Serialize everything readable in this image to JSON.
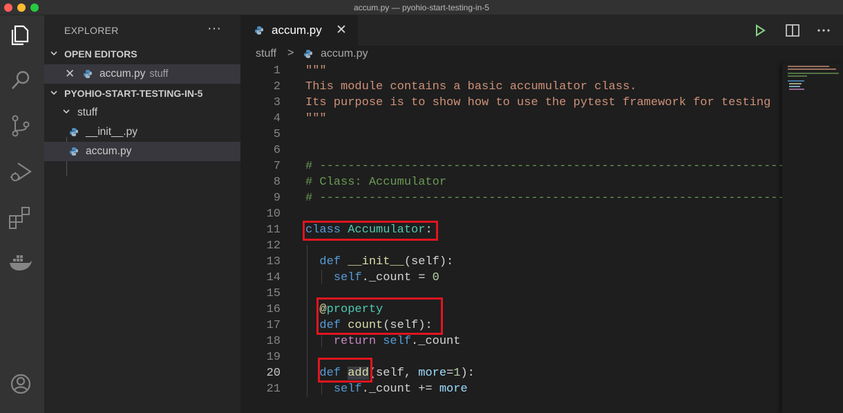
{
  "window": {
    "title": "accum.py — pyohio-start-testing-in-5"
  },
  "activity_bar": {
    "items": [
      {
        "name": "explorer-icon"
      },
      {
        "name": "search-icon"
      },
      {
        "name": "source-control-icon"
      },
      {
        "name": "run-debug-icon"
      },
      {
        "name": "extensions-icon"
      },
      {
        "name": "docker-icon"
      },
      {
        "name": "accounts-icon"
      }
    ]
  },
  "sidebar": {
    "header": "EXPLORER",
    "more_actions": "···",
    "open_editors": {
      "label": "OPEN EDITORS",
      "items": [
        {
          "name": "accum.py",
          "description": "stuff"
        }
      ]
    },
    "workspace": {
      "label": "PYOHIO-START-TESTING-IN-5",
      "folder": "stuff",
      "files": [
        "__init__.py",
        "accum.py"
      ]
    }
  },
  "editor": {
    "tab": {
      "label": "accum.py"
    },
    "breadcrumb": {
      "folder": "stuff",
      "separator": ">",
      "file": "accum.py"
    },
    "active_line": 20,
    "lines": [
      {
        "n": "1",
        "text": "\"\"\""
      },
      {
        "n": "2",
        "text": "This module contains a basic accumulator class."
      },
      {
        "n": "3",
        "text": "Its purpose is to show how to use the pytest framework for testing"
      },
      {
        "n": "4",
        "text": "\"\"\""
      },
      {
        "n": "5",
        "text": ""
      },
      {
        "n": "6",
        "text": ""
      },
      {
        "n": "7",
        "text": "# --------------------------------------------------------------------------"
      },
      {
        "n": "8",
        "text": "# Class: Accumulator"
      },
      {
        "n": "9",
        "text": "# --------------------------------------------------------------------------"
      },
      {
        "n": "10",
        "text": ""
      },
      {
        "n": "11",
        "kw": "class",
        "name": "Accumulator",
        "colon": ":"
      },
      {
        "n": "12",
        "text": ""
      },
      {
        "n": "13",
        "kw": "def",
        "fn": "__init__",
        "params": "(self):"
      },
      {
        "n": "14",
        "obj": "self",
        "attr": "._count = ",
        "num": "0"
      },
      {
        "n": "15",
        "text": ""
      },
      {
        "n": "16",
        "at": "@",
        "decorator": "property"
      },
      {
        "n": "17",
        "kw": "def",
        "fn": "count",
        "params": "(self):"
      },
      {
        "n": "18",
        "ret": "return",
        "obj": "self",
        "attr": "._count"
      },
      {
        "n": "19",
        "text": ""
      },
      {
        "n": "20",
        "kw": "def",
        "fn": "add",
        "p1": "(self, ",
        "p2": "more",
        "p3": "=",
        "num": "1",
        "p4": "):"
      },
      {
        "n": "21",
        "obj": "self",
        "attr": "._count += ",
        "p2": "more"
      }
    ]
  },
  "colors": {
    "string": "#ce9178",
    "comment": "#6a9955",
    "keyword": "#569cd6",
    "class": "#4ec9b0",
    "function": "#dcdcaa",
    "highlight_box": "#e0151f"
  }
}
